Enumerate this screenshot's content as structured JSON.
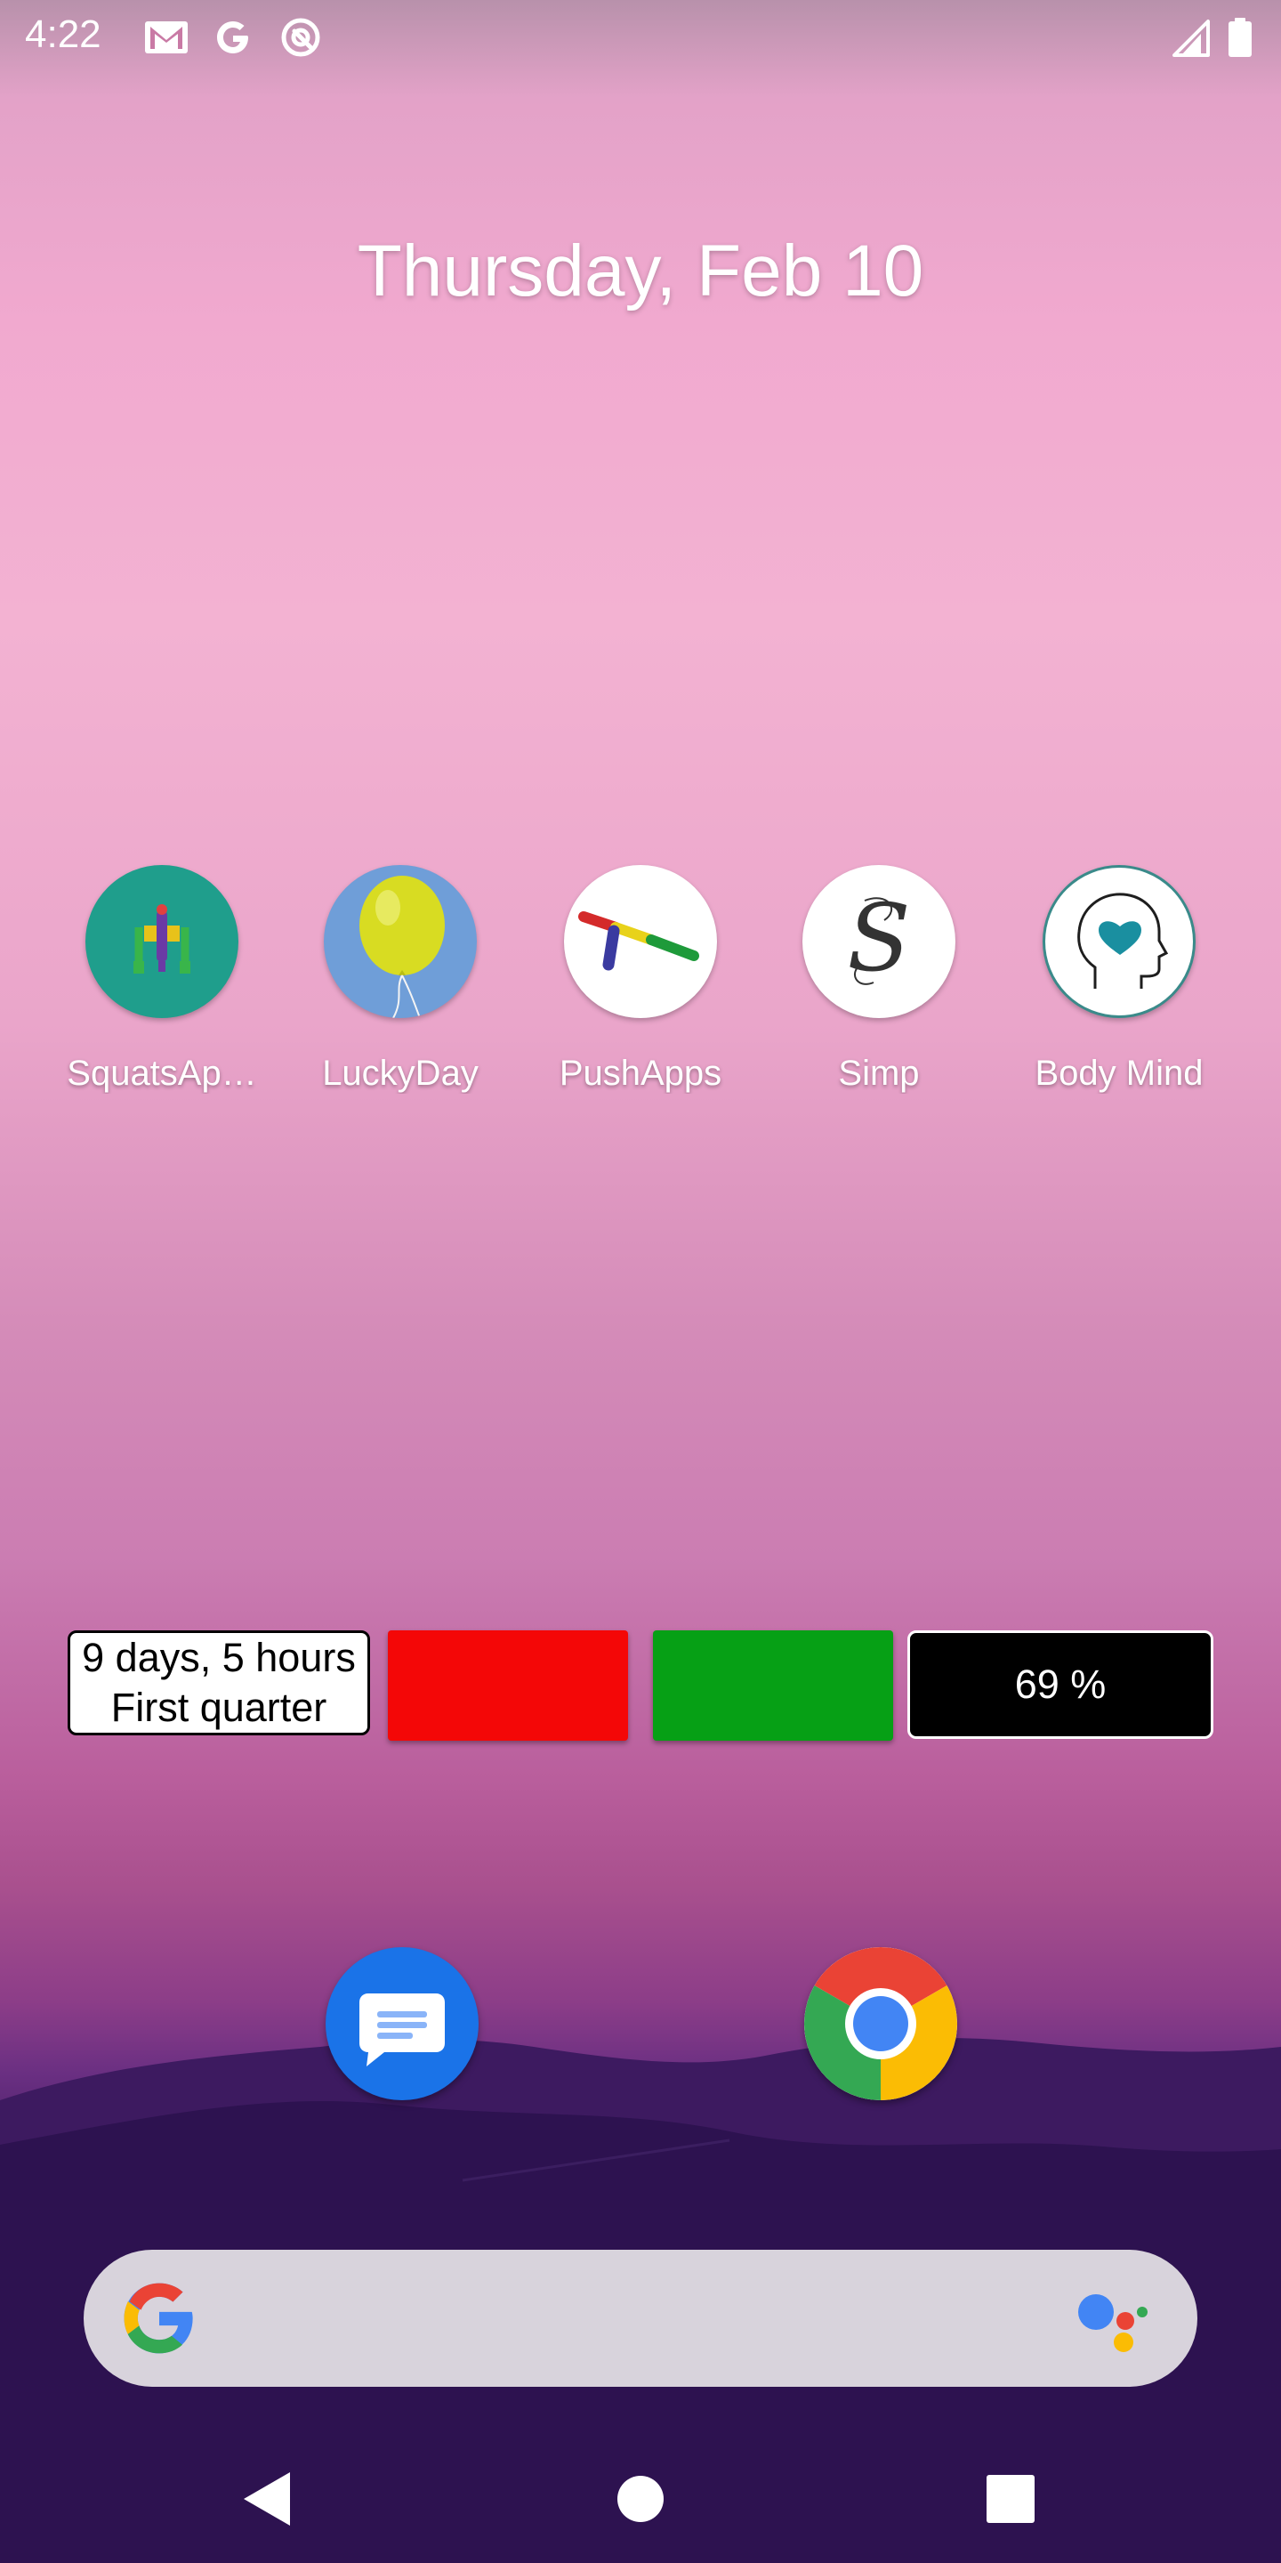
{
  "status_bar": {
    "time": "4:22",
    "left_icons": [
      "gmail-icon",
      "google-icon",
      "rec-icon"
    ],
    "right_icons": [
      "signal-icon",
      "battery-icon"
    ]
  },
  "date_text": "Thursday, Feb 10",
  "apps": [
    {
      "label": "SquatsAp…",
      "icon": "squats-app-icon"
    },
    {
      "label": "LuckyDay",
      "icon": "balloon-icon"
    },
    {
      "label": "PushApps",
      "icon": "pushapps-icon"
    },
    {
      "label": "Simp",
      "icon": "simp-s-icon"
    },
    {
      "label": "Body Mind",
      "icon": "head-heart-icon"
    }
  ],
  "widgets": {
    "countdown": {
      "line1": "9 days, 5 hours",
      "line2": "First quarter"
    },
    "red_color": "#f40707",
    "green_color": "#06a015",
    "battery_text": "69 %"
  },
  "dock": [
    {
      "name": "Messages",
      "icon": "messages-icon"
    },
    {
      "name": "Chrome",
      "icon": "chrome-icon"
    }
  ],
  "search": {
    "logo": "google-g-icon",
    "assistant": "google-assistant-icon"
  },
  "nav": [
    "back-icon",
    "home-icon",
    "recents-icon"
  ]
}
